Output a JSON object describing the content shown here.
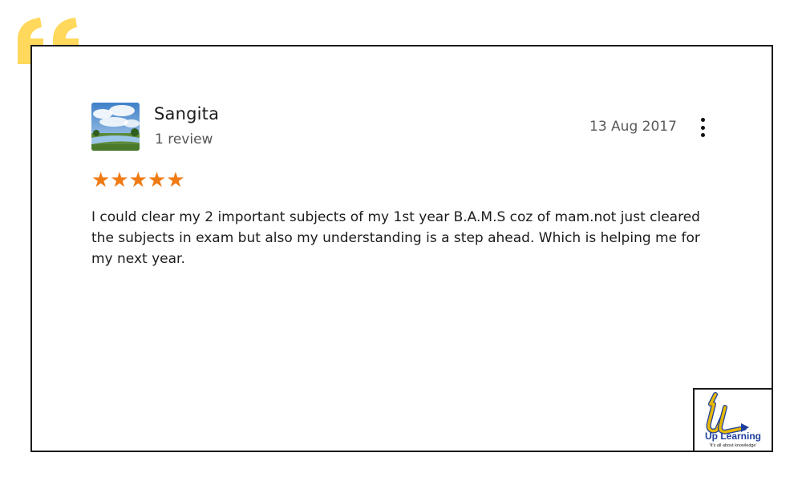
{
  "review": {
    "reviewer_name": "Sangita",
    "review_count": "1 review",
    "date": "13 Aug 2017",
    "rating": 5,
    "stars": "★★★★★",
    "text": "I could clear my 2 important subjects of my 1st year B.A.M.S coz of mam.not just cleared the subjects in exam but also my understanding is a step ahead. Which is helping me for my next year."
  },
  "logo": {
    "name": "Up Learning",
    "tagline": "'It's all about knowledge'"
  },
  "colors": {
    "quote_mark": "#ffd85c",
    "stars": "#f07b15",
    "logo_text": "#1f3f9e",
    "logo_mark": "#e6b800"
  },
  "icons": {
    "quote": "quote-icon",
    "more": "more-vertical-icon",
    "avatar": "landscape-avatar"
  }
}
